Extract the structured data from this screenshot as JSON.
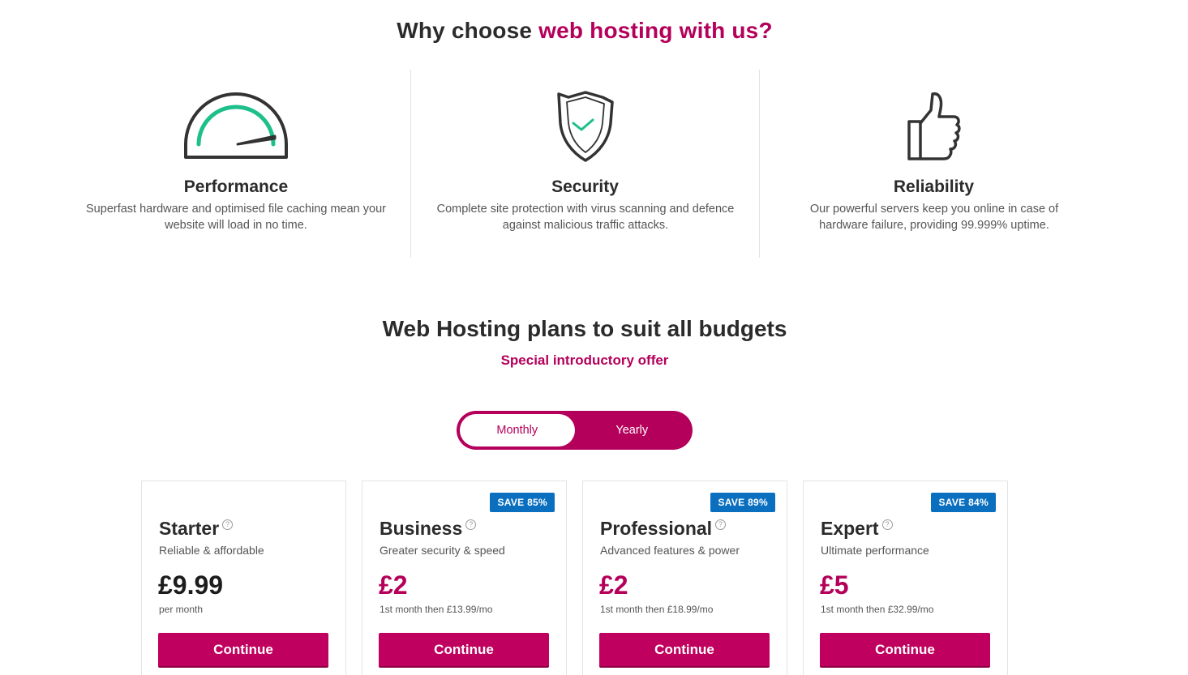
{
  "why": {
    "title_prefix": "Why choose ",
    "title_accent": "web hosting with us?"
  },
  "features": [
    {
      "icon": "speedometer-icon",
      "title": "Performance",
      "desc": "Superfast hardware and optimised file caching mean your website will load in no time."
    },
    {
      "icon": "shield-check-icon",
      "title": "Security",
      "desc": "Complete site protection with virus scanning and defence against malicious traffic attacks."
    },
    {
      "icon": "thumbs-up-icon",
      "title": "Reliability",
      "desc": "Our powerful servers keep you online in case of hardware failure, providing 99.999% uptime."
    }
  ],
  "plans": {
    "title": "Web Hosting plans to suit all budgets",
    "subtitle": "Special introductory offer",
    "billing_toggle": {
      "monthly": "Monthly",
      "yearly": "Yearly",
      "selected": "Monthly"
    },
    "help_glyph": "?",
    "cards": [
      {
        "name": "Starter",
        "tagline": "Reliable & affordable",
        "badge": "",
        "price": "£9.99",
        "note": "per month",
        "cta": "Continue"
      },
      {
        "name": "Business",
        "tagline": "Greater security & speed",
        "badge": "SAVE 85%",
        "price": "£2",
        "note": "1st month then £13.99/mo",
        "cta": "Continue"
      },
      {
        "name": "Professional",
        "tagline": "Advanced features & power",
        "badge": "SAVE 89%",
        "price": "£2",
        "note": "1st month then £18.99/mo",
        "cta": "Continue"
      },
      {
        "name": "Expert",
        "tagline": "Ultimate performance",
        "badge": "SAVE 84%",
        "price": "£5",
        "note": "1st month then £32.99/mo",
        "cta": "Continue"
      }
    ]
  },
  "colors": {
    "brand": "#b4005a",
    "badge": "#0a6fbf",
    "icon_accent": "#1dbf8a",
    "icon_stroke": "#333333"
  }
}
